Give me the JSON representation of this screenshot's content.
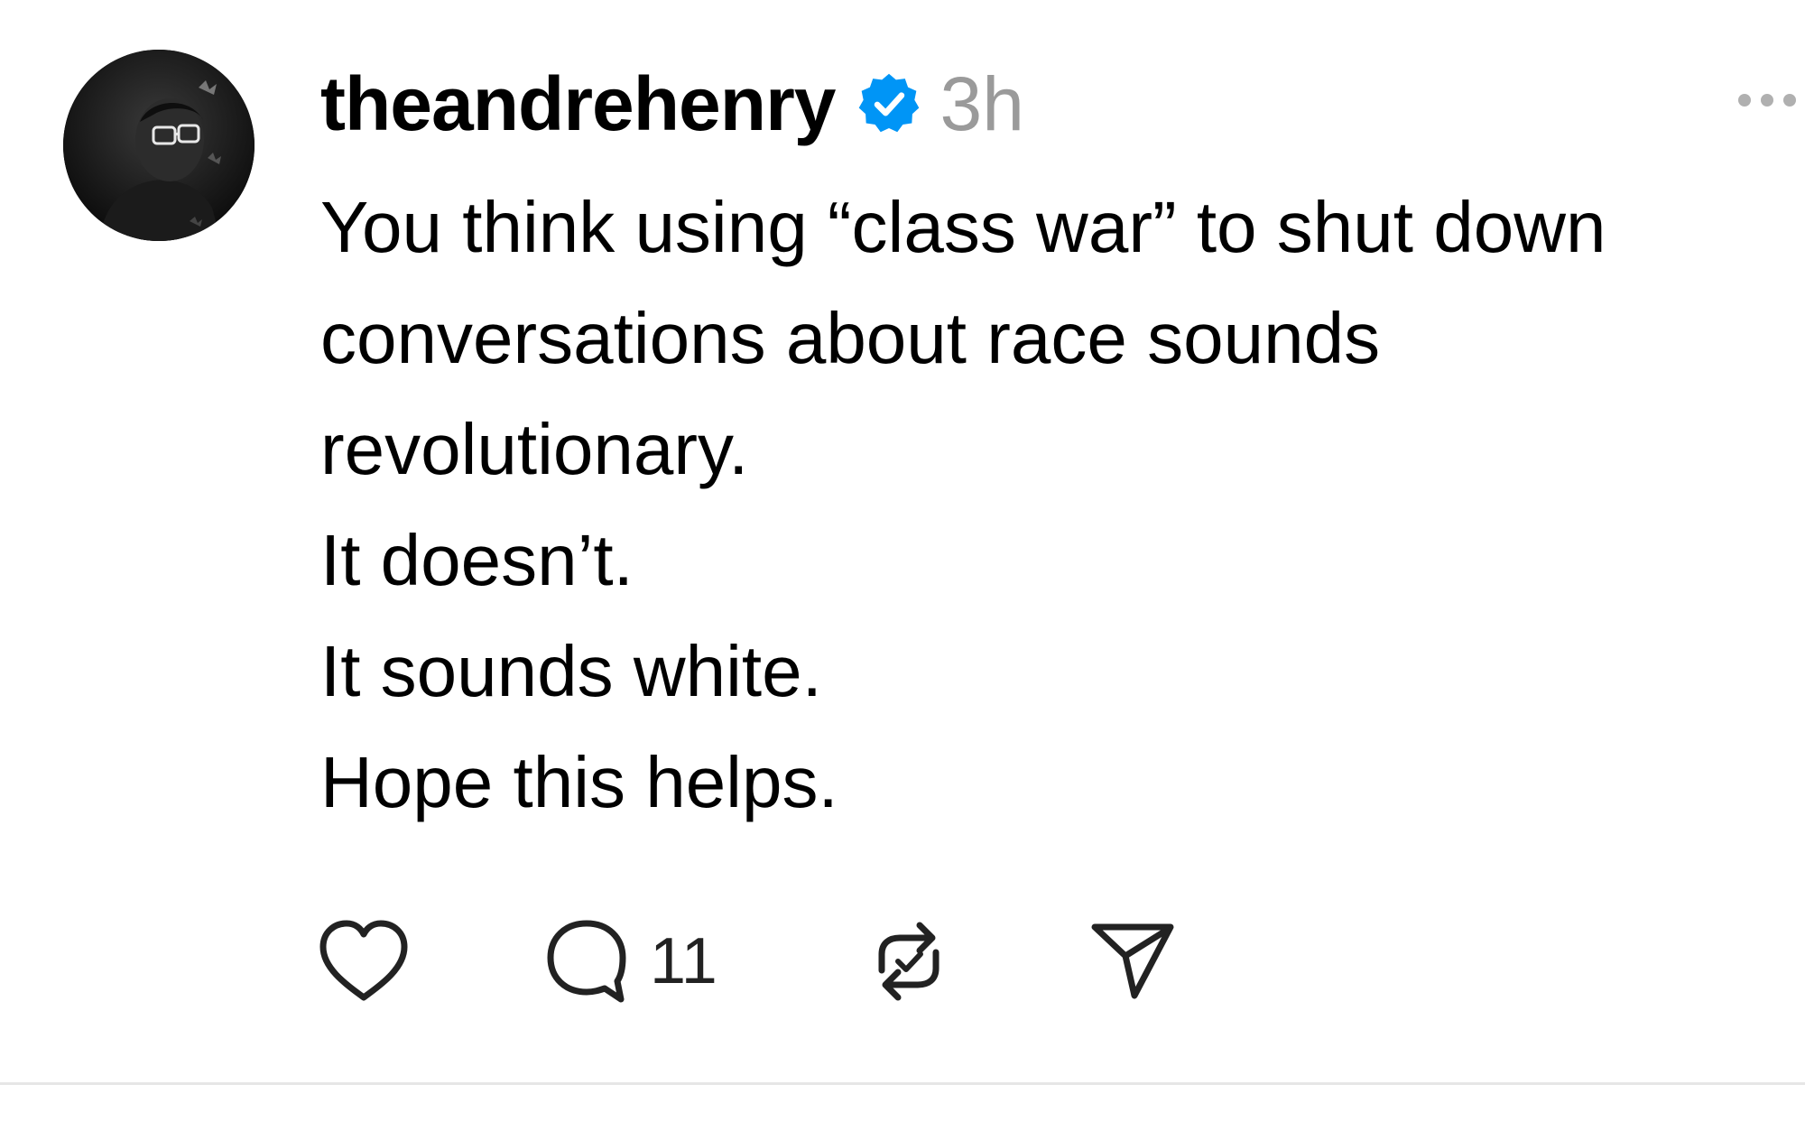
{
  "post": {
    "author": {
      "username": "theandrehenry",
      "verified": true,
      "avatar_icon": "avatar-photo"
    },
    "timestamp": "3h",
    "body_lines": [
      "You think using “class war” to shut down",
      "conversations about race sounds",
      "revolutionary.",
      "It doesn’t.",
      "It sounds white.",
      "Hope this helps."
    ],
    "actions": {
      "like_icon": "heart-icon",
      "reply_icon": "comment-icon",
      "reply_count": "11",
      "repost_icon": "repost-icon",
      "share_icon": "send-icon",
      "more_icon": "more-horizontal-icon"
    }
  },
  "colors": {
    "verified_blue": "#0095f6",
    "timestamp_gray": "#9a9a9a",
    "icon_color": "#222222",
    "divider": "#e6e6e6"
  }
}
